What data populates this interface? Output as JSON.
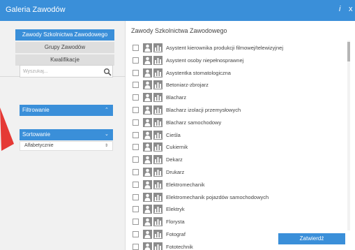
{
  "window": {
    "title": "Galeria Zawodów",
    "info_label": "i",
    "close_label": "x"
  },
  "nav": {
    "items": [
      {
        "label": "Zawody Szkolnictwa Zawodowego",
        "active": true
      },
      {
        "label": "Grupy Zawodów",
        "active": false
      },
      {
        "label": "Kwalifikacje",
        "active": false
      }
    ]
  },
  "search": {
    "placeholder": "Wyszukaj...",
    "value": ""
  },
  "filter": {
    "label": "Filtrowanie",
    "chevron": "⌃"
  },
  "sort": {
    "label": "Sortowanie",
    "chevron": "⌄",
    "selected": "Alfabetycznie",
    "arrows": "⇕"
  },
  "main": {
    "heading": "Zawody Szkolnictwa Zawodowego",
    "items": [
      {
        "label": "Asystent kierownika produkcji filmowej/telewizyjnej"
      },
      {
        "label": "Asystent osoby niepełnosprawnej"
      },
      {
        "label": "Asystentka stomatologiczna"
      },
      {
        "label": "Betoniarz-zbrojarz"
      },
      {
        "label": "Blacharz"
      },
      {
        "label": "Blacharz izolacji przemysłowych"
      },
      {
        "label": "Blacharz samochodowy"
      },
      {
        "label": "Cieśla"
      },
      {
        "label": "Cukiernik"
      },
      {
        "label": "Dekarz"
      },
      {
        "label": "Drukarz"
      },
      {
        "label": "Elektromechanik"
      },
      {
        "label": "Elektromechanik pojazdów samochodowych"
      },
      {
        "label": "Elektryk"
      },
      {
        "label": "Florysta"
      },
      {
        "label": "Fotograf"
      },
      {
        "label": "Fototechnik"
      }
    ],
    "confirm_label": "Zatwierdź"
  },
  "colors": {
    "accent": "#3a8fd9",
    "arrow": "#e53935"
  }
}
